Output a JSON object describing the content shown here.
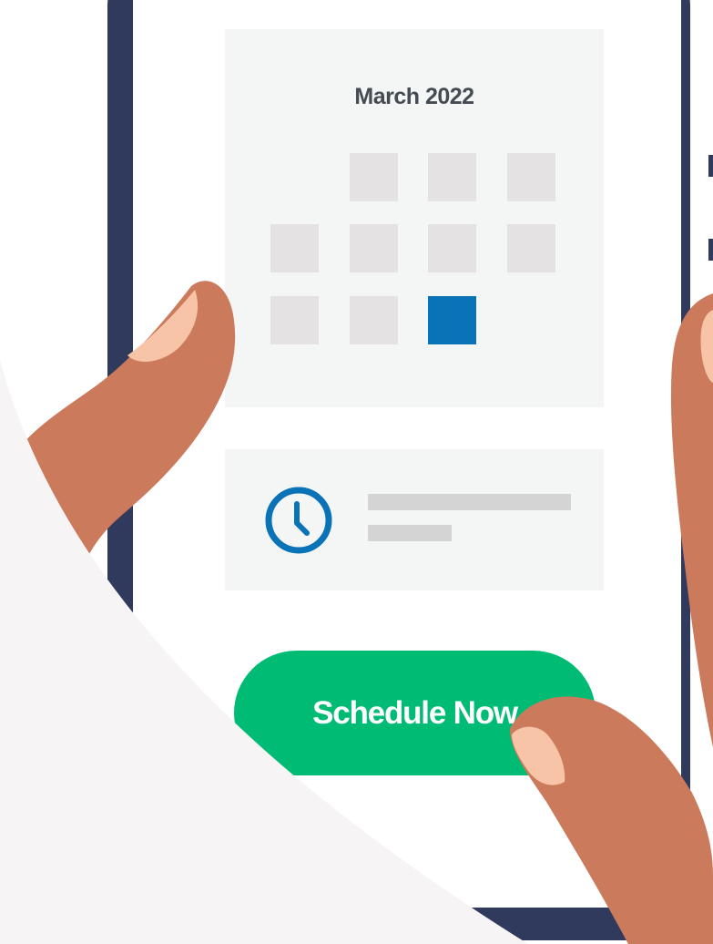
{
  "calendar": {
    "month_label": "March 2022",
    "days": [
      {
        "state": "empty"
      },
      {
        "state": "empty"
      },
      {
        "state": "empty"
      },
      {
        "state": "empty"
      },
      {
        "state": "empty"
      },
      {
        "state": "empty"
      },
      {
        "state": "empty"
      },
      {
        "state": "empty"
      },
      {
        "state": "empty"
      },
      {
        "state": "selected"
      }
    ]
  },
  "time_slot": {
    "icon": "clock-icon"
  },
  "cta": {
    "label": "Schedule Now"
  },
  "colors": {
    "accent_button": "#00bb73",
    "selected_day": "#0a72b6",
    "clock_icon": "#0a72b6",
    "phone_frame": "#303a5c",
    "skin": "#cc7a5c",
    "fingernail": "#f8c4a8"
  }
}
